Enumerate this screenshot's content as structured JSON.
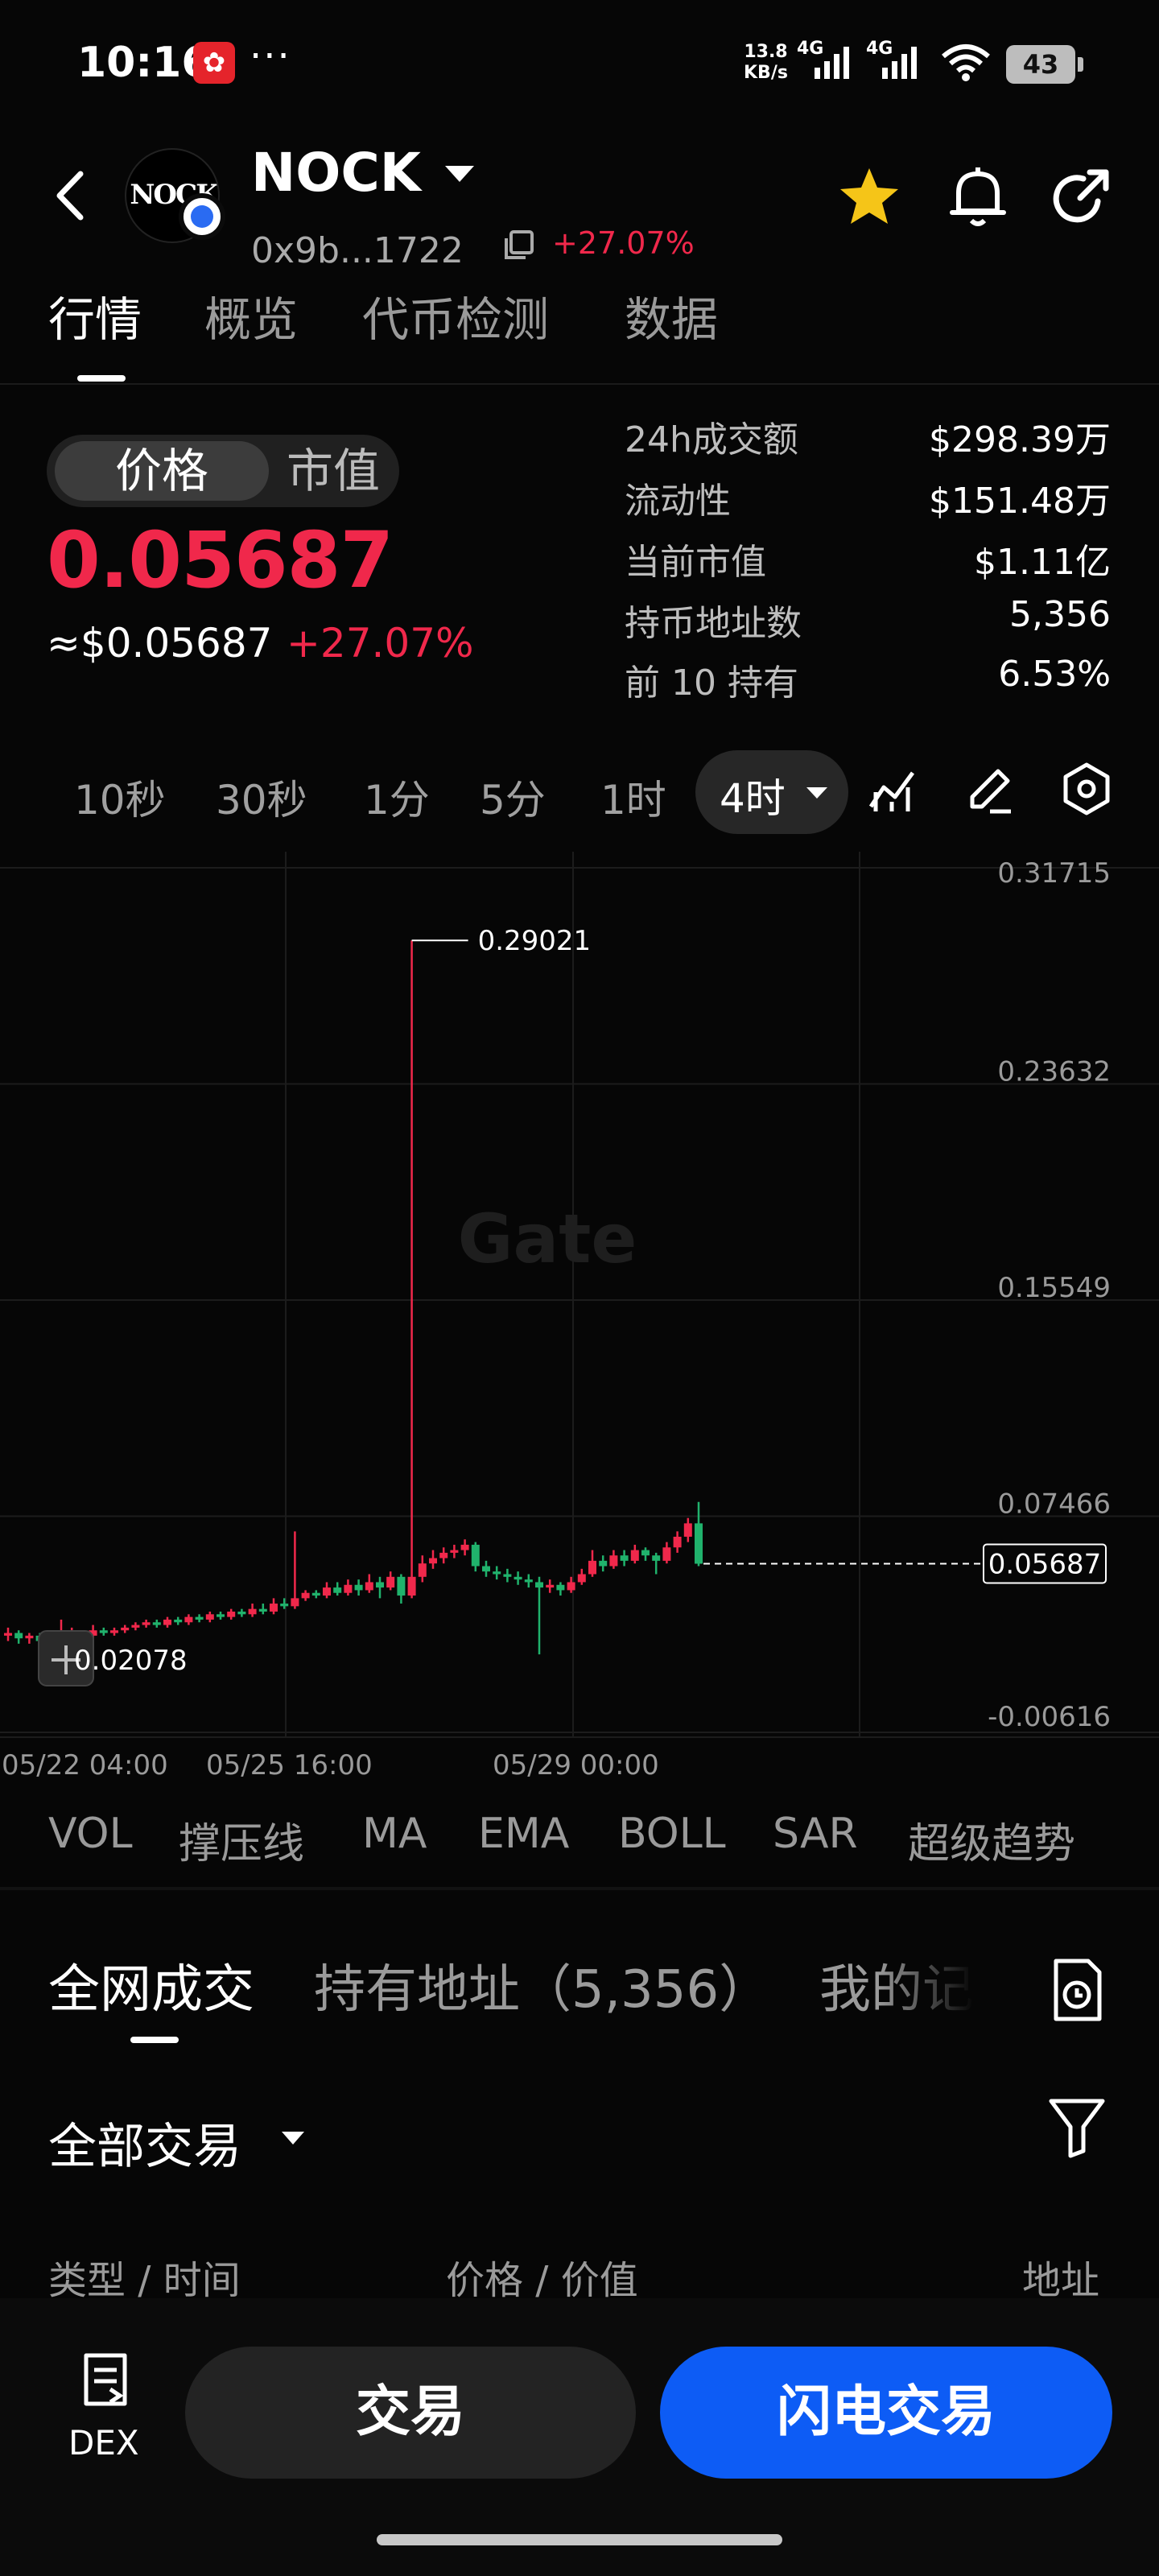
{
  "status_bar": {
    "time": "10:16",
    "dots": "···",
    "speed_value": "13.8",
    "speed_unit": "KB/s",
    "net1": "4G",
    "net2": "4G",
    "battery": "43"
  },
  "header": {
    "symbol": "NOCK",
    "address": "0x9b...1722",
    "change": "+27.07%",
    "logo_text": "NOCK"
  },
  "tabs": [
    "行情",
    "概览",
    "代币检测",
    "数据"
  ],
  "price_toggle": {
    "active": "价格",
    "inactive": "市值"
  },
  "price": {
    "value": "0.05687",
    "usd": "≈$0.05687",
    "change": "+27.07%"
  },
  "stats": [
    {
      "label": "24h成交额",
      "value": "$298.39万"
    },
    {
      "label": "流动性",
      "value": "$151.48万"
    },
    {
      "label": "当前市值",
      "value": "$1.11亿"
    },
    {
      "label": "持币地址数",
      "value": "5,356"
    },
    {
      "label": "前 10 持有",
      "value": "6.53%"
    }
  ],
  "intervals": [
    "10秒",
    "30秒",
    "1分",
    "5分",
    "1时"
  ],
  "active_interval": "4时",
  "chart_data": {
    "type": "candlestick",
    "watermark": "Gate",
    "y_ticks": [
      "0.31715",
      "0.23632",
      "0.15549",
      "0.07466",
      "-0.00616"
    ],
    "ylim": [
      -0.00616,
      0.31715
    ],
    "x_ticks": [
      "05/22 04:00",
      "05/25 16:00",
      "05/29 00:00"
    ],
    "high_label": "0.29021",
    "low_label": "0.02078",
    "current_label": "0.05687",
    "up_color": "#f0284b",
    "down_color": "#20b26c",
    "candles": [
      {
        "o": 0.03,
        "c": 0.031,
        "h": 0.033,
        "l": 0.028
      },
      {
        "o": 0.031,
        "c": 0.029,
        "h": 0.032,
        "l": 0.027
      },
      {
        "o": 0.029,
        "c": 0.03,
        "h": 0.031,
        "l": 0.027
      },
      {
        "o": 0.03,
        "c": 0.028,
        "h": 0.031,
        "l": 0.026
      },
      {
        "o": 0.028,
        "c": 0.026,
        "h": 0.029,
        "l": 0.021
      },
      {
        "o": 0.026,
        "c": 0.03,
        "h": 0.036,
        "l": 0.025
      },
      {
        "o": 0.03,
        "c": 0.031,
        "h": 0.033,
        "l": 0.029
      },
      {
        "o": 0.031,
        "c": 0.03,
        "h": 0.032,
        "l": 0.029
      },
      {
        "o": 0.03,
        "c": 0.032,
        "h": 0.034,
        "l": 0.029
      },
      {
        "o": 0.032,
        "c": 0.031,
        "h": 0.033,
        "l": 0.03
      },
      {
        "o": 0.031,
        "c": 0.032,
        "h": 0.033,
        "l": 0.03
      },
      {
        "o": 0.032,
        "c": 0.033,
        "h": 0.034,
        "l": 0.031
      },
      {
        "o": 0.033,
        "c": 0.034,
        "h": 0.035,
        "l": 0.032
      },
      {
        "o": 0.034,
        "c": 0.035,
        "h": 0.036,
        "l": 0.033
      },
      {
        "o": 0.035,
        "c": 0.034,
        "h": 0.036,
        "l": 0.033
      },
      {
        "o": 0.034,
        "c": 0.036,
        "h": 0.037,
        "l": 0.033
      },
      {
        "o": 0.036,
        "c": 0.035,
        "h": 0.037,
        "l": 0.034
      },
      {
        "o": 0.035,
        "c": 0.037,
        "h": 0.038,
        "l": 0.034
      },
      {
        "o": 0.037,
        "c": 0.036,
        "h": 0.038,
        "l": 0.035
      },
      {
        "o": 0.036,
        "c": 0.038,
        "h": 0.039,
        "l": 0.035
      },
      {
        "o": 0.038,
        "c": 0.037,
        "h": 0.039,
        "l": 0.036
      },
      {
        "o": 0.037,
        "c": 0.039,
        "h": 0.04,
        "l": 0.036
      },
      {
        "o": 0.039,
        "c": 0.038,
        "h": 0.04,
        "l": 0.037
      },
      {
        "o": 0.038,
        "c": 0.04,
        "h": 0.042,
        "l": 0.037
      },
      {
        "o": 0.04,
        "c": 0.039,
        "h": 0.042,
        "l": 0.038
      },
      {
        "o": 0.039,
        "c": 0.042,
        "h": 0.044,
        "l": 0.038
      },
      {
        "o": 0.042,
        "c": 0.041,
        "h": 0.044,
        "l": 0.04
      },
      {
        "o": 0.041,
        "c": 0.044,
        "h": 0.069,
        "l": 0.04
      },
      {
        "o": 0.044,
        "c": 0.046,
        "h": 0.047,
        "l": 0.043
      },
      {
        "o": 0.046,
        "c": 0.045,
        "h": 0.047,
        "l": 0.044
      },
      {
        "o": 0.045,
        "c": 0.048,
        "h": 0.05,
        "l": 0.044
      },
      {
        "o": 0.048,
        "c": 0.046,
        "h": 0.05,
        "l": 0.045
      },
      {
        "o": 0.046,
        "c": 0.049,
        "h": 0.051,
        "l": 0.045
      },
      {
        "o": 0.049,
        "c": 0.047,
        "h": 0.051,
        "l": 0.045
      },
      {
        "o": 0.047,
        "c": 0.05,
        "h": 0.053,
        "l": 0.046
      },
      {
        "o": 0.05,
        "c": 0.048,
        "h": 0.052,
        "l": 0.044
      },
      {
        "o": 0.048,
        "c": 0.052,
        "h": 0.054,
        "l": 0.047
      },
      {
        "o": 0.052,
        "c": 0.045,
        "h": 0.053,
        "l": 0.042
      },
      {
        "o": 0.045,
        "c": 0.052,
        "h": 0.29,
        "l": 0.044
      },
      {
        "o": 0.052,
        "c": 0.057,
        "h": 0.06,
        "l": 0.05
      },
      {
        "o": 0.057,
        "c": 0.059,
        "h": 0.062,
        "l": 0.055
      },
      {
        "o": 0.059,
        "c": 0.061,
        "h": 0.063,
        "l": 0.057
      },
      {
        "o": 0.061,
        "c": 0.062,
        "h": 0.064,
        "l": 0.059
      },
      {
        "o": 0.062,
        "c": 0.064,
        "h": 0.066,
        "l": 0.06
      },
      {
        "o": 0.064,
        "c": 0.056,
        "h": 0.065,
        "l": 0.054
      },
      {
        "o": 0.056,
        "c": 0.054,
        "h": 0.058,
        "l": 0.052
      },
      {
        "o": 0.054,
        "c": 0.053,
        "h": 0.056,
        "l": 0.051
      },
      {
        "o": 0.053,
        "c": 0.052,
        "h": 0.055,
        "l": 0.05
      },
      {
        "o": 0.052,
        "c": 0.051,
        "h": 0.054,
        "l": 0.049
      },
      {
        "o": 0.051,
        "c": 0.05,
        "h": 0.053,
        "l": 0.048
      },
      {
        "o": 0.05,
        "c": 0.048,
        "h": 0.052,
        "l": 0.023
      },
      {
        "o": 0.048,
        "c": 0.049,
        "h": 0.051,
        "l": 0.046
      },
      {
        "o": 0.049,
        "c": 0.047,
        "h": 0.05,
        "l": 0.045
      },
      {
        "o": 0.047,
        "c": 0.05,
        "h": 0.052,
        "l": 0.046
      },
      {
        "o": 0.05,
        "c": 0.053,
        "h": 0.055,
        "l": 0.049
      },
      {
        "o": 0.053,
        "c": 0.058,
        "h": 0.062,
        "l": 0.052
      },
      {
        "o": 0.058,
        "c": 0.056,
        "h": 0.06,
        "l": 0.054
      },
      {
        "o": 0.056,
        "c": 0.06,
        "h": 0.062,
        "l": 0.055
      },
      {
        "o": 0.06,
        "c": 0.058,
        "h": 0.062,
        "l": 0.056
      },
      {
        "o": 0.058,
        "c": 0.062,
        "h": 0.064,
        "l": 0.057
      },
      {
        "o": 0.062,
        "c": 0.06,
        "h": 0.063,
        "l": 0.058
      },
      {
        "o": 0.06,
        "c": 0.058,
        "h": 0.061,
        "l": 0.053
      },
      {
        "o": 0.058,
        "c": 0.063,
        "h": 0.065,
        "l": 0.057
      },
      {
        "o": 0.063,
        "c": 0.067,
        "h": 0.069,
        "l": 0.061
      },
      {
        "o": 0.067,
        "c": 0.072,
        "h": 0.074,
        "l": 0.065
      },
      {
        "o": 0.072,
        "c": 0.0569,
        "h": 0.08,
        "l": 0.056
      }
    ]
  },
  "indicators": [
    "VOL",
    "撑压线",
    "MA",
    "EMA",
    "BOLL",
    "SAR",
    "超级趋势"
  ],
  "lower_tabs": [
    "全网成交",
    "持有地址（5,356）",
    "我的记"
  ],
  "filter": {
    "label": "全部交易"
  },
  "table_headers": {
    "type_time": "类型 / 时间",
    "price_value": "价格 / 价值",
    "address": "地址"
  },
  "bottom": {
    "dex": "DEX",
    "trade": "交易",
    "flash": "闪电交易"
  }
}
